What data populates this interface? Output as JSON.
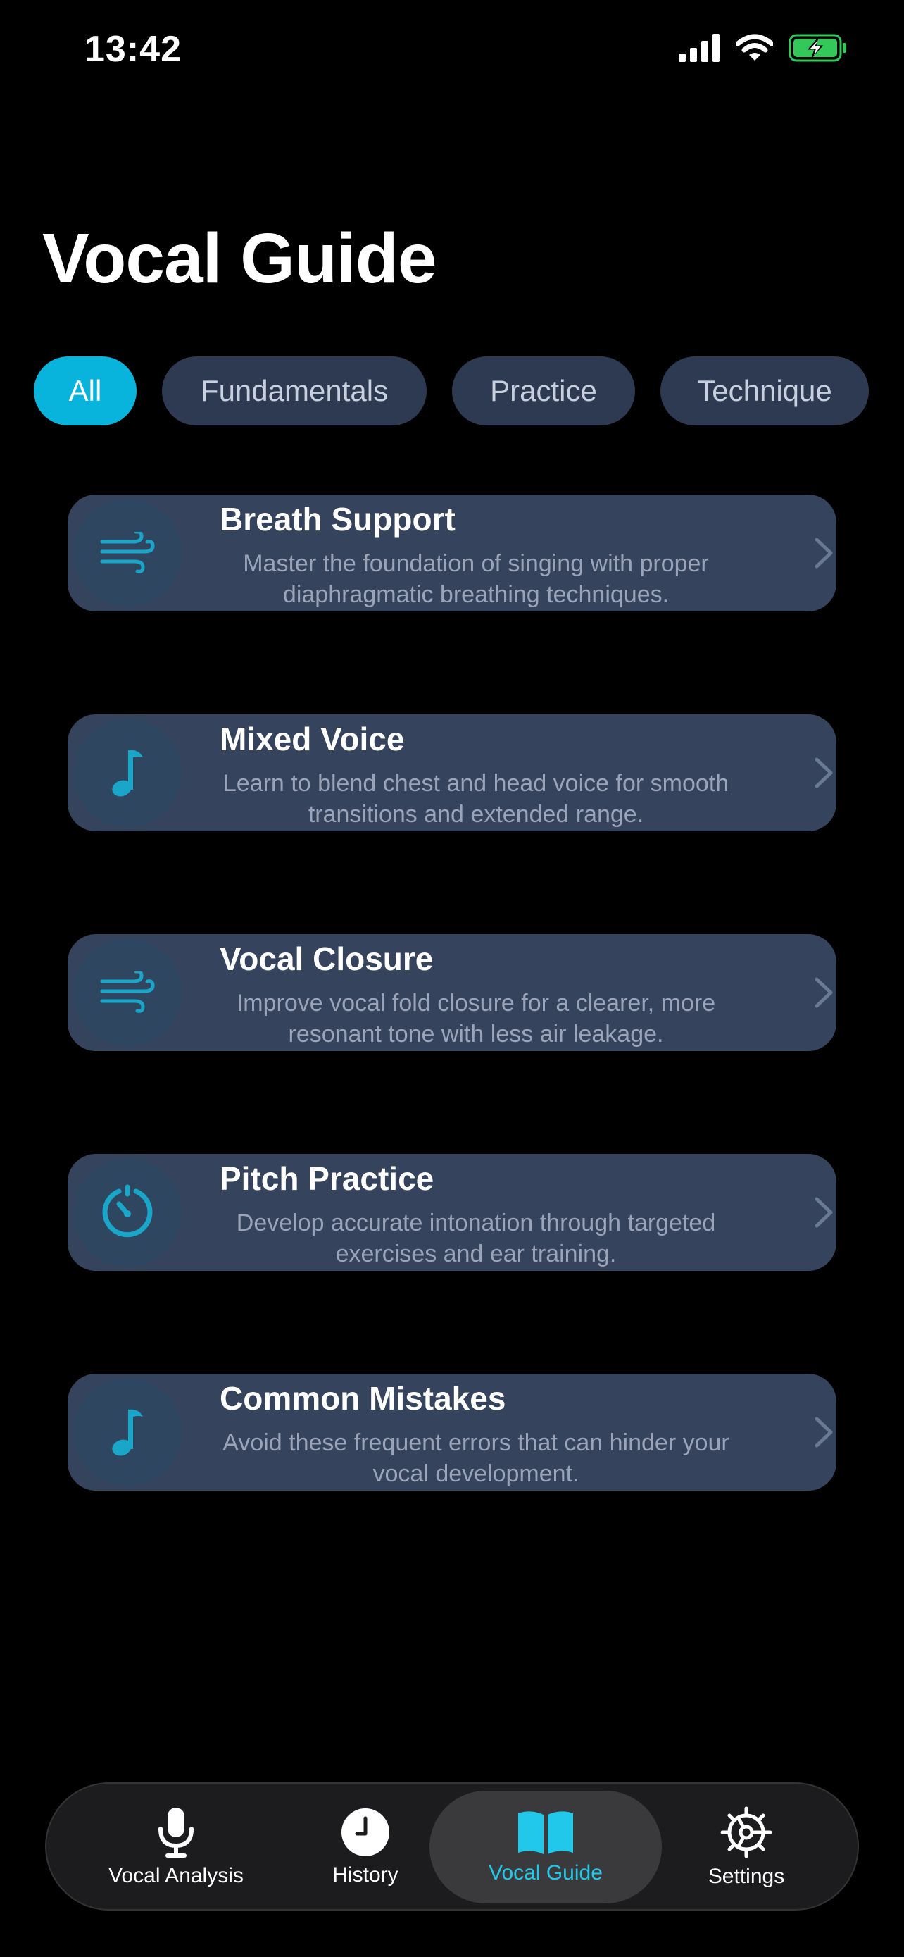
{
  "status": {
    "time": "13:42"
  },
  "title": "Vocal Guide",
  "filters": [
    {
      "label": "All",
      "active": true
    },
    {
      "label": "Fundamentals",
      "active": false
    },
    {
      "label": "Practice",
      "active": false
    },
    {
      "label": "Technique",
      "active": false
    }
  ],
  "cards": [
    {
      "title": "Breath Support",
      "desc": "Master the foundation of singing with proper diaphragmatic breathing techniques.",
      "icon": "wind-icon"
    },
    {
      "title": "Mixed Voice",
      "desc": "Learn to blend chest and head voice for smooth transitions and extended range.",
      "icon": "music-note-icon"
    },
    {
      "title": "Vocal Closure",
      "desc": "Improve vocal fold closure for a clearer, more resonant tone with less air leakage.",
      "icon": "wind-icon"
    },
    {
      "title": "Pitch Practice",
      "desc": "Develop accurate intonation through targeted exercises and ear training.",
      "icon": "gauge-icon"
    },
    {
      "title": "Common Mistakes",
      "desc": "Avoid these frequent errors that can hinder your vocal development.",
      "icon": "music-note-icon"
    }
  ],
  "tabs": [
    {
      "label": "Vocal Analysis",
      "icon": "microphone-icon",
      "active": false
    },
    {
      "label": "History",
      "icon": "clock-icon",
      "active": false
    },
    {
      "label": "Vocal Guide",
      "icon": "book-icon",
      "active": true
    },
    {
      "label": "Settings",
      "icon": "gear-icon",
      "active": false
    }
  ],
  "colors": {
    "accent": "#08b4dc",
    "card": "#35435d",
    "chip": "#2e3a52",
    "battery": "#34c759"
  }
}
